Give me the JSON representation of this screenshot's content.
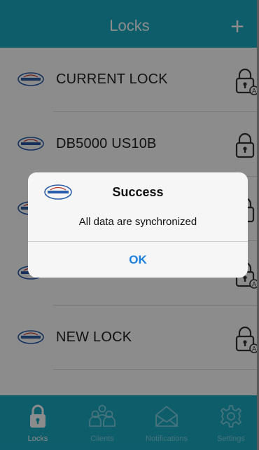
{
  "header": {
    "title": "Locks",
    "add_label": "+"
  },
  "locks": [
    {
      "name": "CURRENT LOCK",
      "auto_badge": "A"
    },
    {
      "name": "DB5000 US10B",
      "auto_badge": ""
    },
    {
      "name": "",
      "auto_badge": ""
    },
    {
      "name": "",
      "auto_badge": "A"
    },
    {
      "name": "NEW LOCK",
      "auto_badge": "A"
    }
  ],
  "tabs": [
    {
      "label": "Locks",
      "icon": "lock-icon",
      "active": true
    },
    {
      "label": "Clients",
      "icon": "users-icon",
      "active": false
    },
    {
      "label": "Notifications",
      "icon": "envelope-icon",
      "active": false
    },
    {
      "label": "Settings",
      "icon": "gear-icon",
      "active": false
    }
  ],
  "alert": {
    "title": "Success",
    "message": "All data are synchronized",
    "ok_label": "OK"
  },
  "colors": {
    "brand": "#1aa9c4",
    "link": "#1a7fe0"
  }
}
